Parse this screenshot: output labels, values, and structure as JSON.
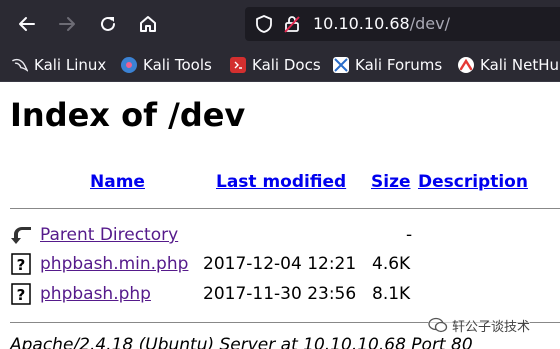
{
  "browser": {
    "url_host": "10.10.10.68",
    "url_path": "/dev/"
  },
  "bookmarks": [
    {
      "label": "Kali Linux",
      "icon": "kali-dragon-icon"
    },
    {
      "label": "Kali Tools",
      "icon": "kali-tools-icon"
    },
    {
      "label": "Kali Docs",
      "icon": "kali-docs-icon"
    },
    {
      "label": "Kali Forums",
      "icon": "kali-forums-icon"
    },
    {
      "label": "Kali NetHu",
      "icon": "kali-nethunter-icon"
    }
  ],
  "page": {
    "title": "Index of /dev",
    "columns": {
      "name": "Name",
      "last_modified": "Last modified",
      "size": "Size",
      "description": "Description"
    },
    "parent": {
      "label": "Parent Directory",
      "size": "-"
    },
    "files": [
      {
        "name": "phpbash.min.php",
        "modified": "2017-12-04 12:21",
        "size": "4.6K"
      },
      {
        "name": "phpbash.php",
        "modified": "2017-11-30 23:56",
        "size": "8.1K"
      }
    ],
    "address": "Apache/2.4.18 (Ubuntu) Server at 10.10.10.68 Port 80"
  },
  "watermark": {
    "text": "轩公子谈技术"
  }
}
